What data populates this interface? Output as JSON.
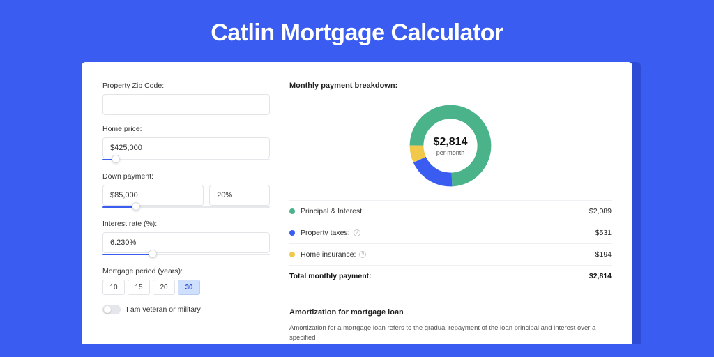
{
  "title": "Catlin Mortgage Calculator",
  "form": {
    "zip_label": "Property Zip Code:",
    "zip_value": "",
    "home_price_label": "Home price:",
    "home_price_value": "$425,000",
    "home_price_slider_pct": 8,
    "down_payment_label": "Down payment:",
    "down_payment_value": "$85,000",
    "down_payment_pct_value": "20%",
    "down_payment_slider_pct": 20,
    "interest_label": "Interest rate (%):",
    "interest_value": "6.230%",
    "interest_slider_pct": 30,
    "period_label": "Mortgage period (years):",
    "period_options": [
      "10",
      "15",
      "20",
      "30"
    ],
    "period_active": "30",
    "veteran_label": "I am veteran or military"
  },
  "breakdown": {
    "title": "Monthly payment breakdown:",
    "center_amount": "$2,814",
    "center_sub": "per month",
    "items": [
      {
        "label": "Principal & Interest:",
        "value": "$2,089",
        "color": "#4bb38a",
        "raw": 2089,
        "info": false
      },
      {
        "label": "Property taxes:",
        "value": "$531",
        "color": "#3a5cf0",
        "raw": 531,
        "info": true
      },
      {
        "label": "Home insurance:",
        "value": "$194",
        "color": "#f0c94b",
        "raw": 194,
        "info": true
      }
    ],
    "total_label": "Total monthly payment:",
    "total_value": "$2,814"
  },
  "amortization": {
    "title": "Amortization for mortgage loan",
    "text": "Amortization for a mortgage loan refers to the gradual repayment of the loan principal and interest over a specified"
  },
  "chart_data": {
    "type": "pie",
    "title": "Monthly payment breakdown",
    "series": [
      {
        "name": "Principal & Interest",
        "value": 2089,
        "color": "#4bb38a"
      },
      {
        "name": "Property taxes",
        "value": 531,
        "color": "#3a5cf0"
      },
      {
        "name": "Home insurance",
        "value": 194,
        "color": "#f0c94b"
      }
    ],
    "total": 2814,
    "center_label": "$2,814 per month"
  }
}
